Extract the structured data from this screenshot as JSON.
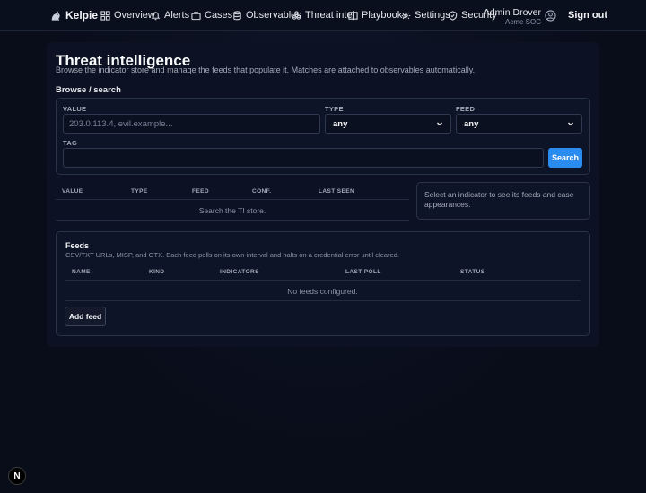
{
  "brand": {
    "name": "Kelpie"
  },
  "nav": {
    "items": [
      {
        "label": "Overview",
        "icon": "grid-icon"
      },
      {
        "label": "Alerts",
        "icon": "bell-icon"
      },
      {
        "label": "Cases",
        "icon": "briefcase-icon"
      },
      {
        "label": "Observables",
        "icon": "database-icon"
      },
      {
        "label": "Threat intel",
        "icon": "biohazard-icon"
      },
      {
        "label": "Playbooks",
        "icon": "book-icon"
      },
      {
        "label": "Settings",
        "icon": "gear-icon"
      },
      {
        "label": "Security",
        "icon": "shield-icon"
      }
    ],
    "user_name": "Admin Drover",
    "user_org": "Acme SOC",
    "signout": "Sign out"
  },
  "page": {
    "title": "Threat intelligence",
    "subtitle": "Browse the indicator store and manage the feeds that populate it. Matches are attached to observables automatically."
  },
  "browse": {
    "heading": "Browse / search",
    "value_label": "VALUE",
    "value_placeholder": "203.0.113.4, evil.example...",
    "type_label": "TYPE",
    "type_value": "any",
    "feed_label": "FEED",
    "feed_value": "any",
    "tag_label": "TAG",
    "tag_value": "",
    "search_button": "Search"
  },
  "indicators_table": {
    "columns": [
      "VALUE",
      "TYPE",
      "FEED",
      "CONF.",
      "LAST SEEN"
    ],
    "empty_text": "Search the TI store."
  },
  "detail_hint": "Select an indicator to see its feeds and case appearances.",
  "feeds": {
    "title": "Feeds",
    "description": "CSV/TXT URLs, MISP, and OTX. Each feed polls on its own interval and halts on a credential error until cleared.",
    "columns": [
      "NAME",
      "KIND",
      "INDICATORS",
      "LAST POLL",
      "STATUS"
    ],
    "empty_text": "No feeds configured.",
    "add_button": "Add feed"
  },
  "dev_badge": "N",
  "colors": {
    "accent": "#2b8cf0",
    "background": "#090d1a"
  }
}
